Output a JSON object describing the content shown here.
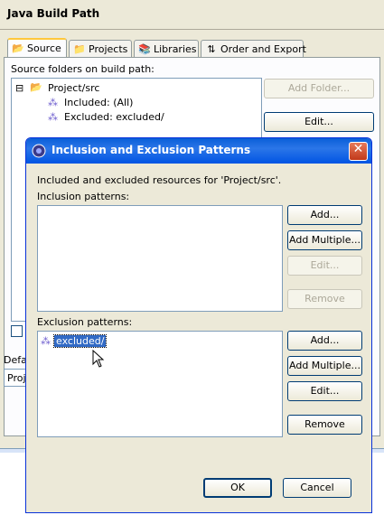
{
  "window": {
    "title": "Java Build Path"
  },
  "tabs": [
    {
      "label": "Source",
      "icon": "source-folder-icon",
      "selected": true
    },
    {
      "label": "Projects",
      "icon": "projects-icon",
      "selected": false
    },
    {
      "label": "Libraries",
      "icon": "libraries-icon",
      "selected": false
    },
    {
      "label": "Order and Export",
      "icon": "order-export-icon",
      "selected": false
    }
  ],
  "source": {
    "folders_label": "Source folders on build path:",
    "tree": {
      "root": "Project/src",
      "children": [
        "Included: (All)",
        "Excluded: excluded/"
      ]
    },
    "buttons": {
      "add_folder": "Add Folder...",
      "edit": "Edit..."
    },
    "default_label": "Defa",
    "output_value": "Proj"
  },
  "dialog": {
    "title": "Inclusion and Exclusion Patterns",
    "description": "Included and excluded resources for 'Project/src'.",
    "inclusion": {
      "label": "Inclusion patterns:",
      "items": [],
      "buttons": {
        "add": "Add...",
        "add_multiple": "Add Multiple...",
        "edit": "Edit...",
        "remove": "Remove"
      }
    },
    "exclusion": {
      "label": "Exclusion patterns:",
      "items": [
        "excluded/"
      ],
      "buttons": {
        "add": "Add...",
        "add_multiple": "Add Multiple...",
        "edit": "Edit...",
        "remove": "Remove"
      }
    },
    "ok": "OK",
    "cancel": "Cancel"
  },
  "colors": {
    "title_bar": "#0054e3",
    "selection": "#316ac5",
    "tab_highlight": "#ffc83c"
  }
}
